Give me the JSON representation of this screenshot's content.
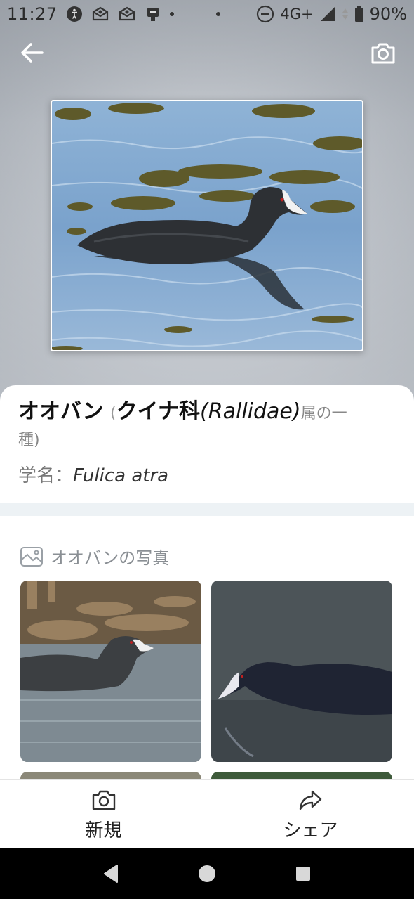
{
  "status_bar": {
    "time": "11:27",
    "network": "4G+",
    "battery": "90%"
  },
  "header": {
    "back_icon": "arrow-left-icon",
    "camera_icon": "camera-icon"
  },
  "species": {
    "name": "オオバン",
    "paren_open": "(",
    "family": "クイナ科",
    "family_latin": "(Rallidae)",
    "rest": "属の一",
    "rest_line2": "種)",
    "sci_label": "学名：",
    "sci_name": "Fulica atra"
  },
  "gallery": {
    "title": "オオバンの写真",
    "icon": "image-icon"
  },
  "bottom_bar": {
    "new_label": "新規",
    "new_icon": "camera-icon",
    "share_label": "シェア",
    "share_icon": "share-icon"
  },
  "colors": {
    "card_bg": "#ffffff",
    "divider": "#edf2f5",
    "muted_text": "#8a8f94"
  }
}
